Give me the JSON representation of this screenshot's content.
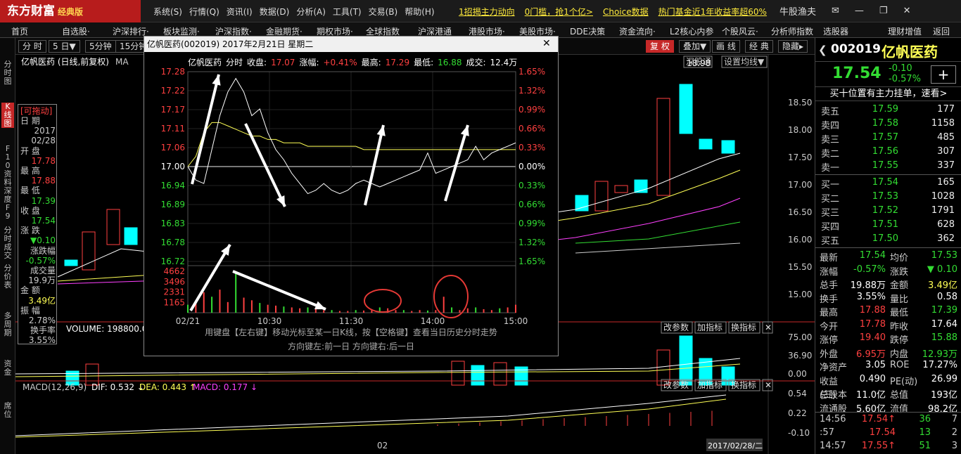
{
  "app": {
    "logo": "东方财富",
    "edition": "经典版",
    "user": "牛股渔夫"
  },
  "menu": [
    "系统(S)",
    "行情(Q)",
    "资讯(I)",
    "数据(D)",
    "分析(A)",
    "工具(T)",
    "交易(B)",
    "帮助(H)"
  ],
  "top_links": [
    "1招揭主力动向",
    "0门槛，抢1个亿>",
    "Choice数据",
    "热门基金近1年收益率超60%"
  ],
  "nav": [
    "首页",
    "自选股·",
    "沪深排行·",
    "板块监测·",
    "沪深指数·",
    "金融期货·",
    "期权市场·",
    "全球指数",
    "沪深港通",
    "港股市场·",
    "美股市场·",
    "DDE决策",
    "资金流向·",
    "L2核心内参",
    "个股风云·",
    "分析师指数",
    "选股器",
    "理财增值",
    "返回"
  ],
  "left_tabs": [
    "分时图",
    "K线图",
    "F10资料",
    "深度F9",
    "分时成交",
    "分价表",
    "多周期",
    "资金",
    "席位"
  ],
  "toolbar": {
    "left": [
      "分 时",
      "5 日▼",
      "5分钟",
      "15分钟"
    ],
    "right": [
      "复 权",
      "叠加▼",
      "画 线",
      "经 典",
      "隐藏▸"
    ]
  },
  "stock": {
    "code": "002019",
    "name": "亿帆医药",
    "price": "17.54",
    "change": "-0.10",
    "pct": "-0.57%"
  },
  "top10": "买十位置有主力挂单，速看>",
  "asks": [
    {
      "n": "卖五",
      "p": "17.59",
      "v": "177"
    },
    {
      "n": "卖四",
      "p": "17.58",
      "v": "1158"
    },
    {
      "n": "卖三",
      "p": "17.57",
      "v": "485"
    },
    {
      "n": "卖二",
      "p": "17.56",
      "v": "307"
    },
    {
      "n": "卖一",
      "p": "17.55",
      "v": "337"
    }
  ],
  "bids": [
    {
      "n": "买一",
      "p": "17.54",
      "v": "165"
    },
    {
      "n": "买二",
      "p": "17.53",
      "v": "1028"
    },
    {
      "n": "买三",
      "p": "17.52",
      "v": "1791"
    },
    {
      "n": "买四",
      "p": "17.51",
      "v": "628"
    },
    {
      "n": "买五",
      "p": "17.50",
      "v": "362"
    }
  ],
  "info": [
    {
      "a": "最新",
      "b": "17.54",
      "bc": "green",
      "c": "均价",
      "d": "17.53",
      "dc": "green"
    },
    {
      "a": "涨幅",
      "b": "-0.57%",
      "bc": "green",
      "c": "涨跌",
      "d": "▼ 0.10",
      "dc": "green"
    },
    {
      "a": "总手",
      "b": "19.88万",
      "bc": "wh",
      "c": "金额",
      "d": "3.49亿",
      "dc": "yel"
    },
    {
      "a": "换手",
      "b": "3.55%",
      "bc": "wh",
      "c": "量比",
      "d": "0.58",
      "dc": "wh"
    },
    {
      "a": "最高",
      "b": "17.88",
      "bc": "red",
      "c": "最低",
      "d": "17.39",
      "dc": "green"
    },
    {
      "a": "今开",
      "b": "17.78",
      "bc": "red",
      "c": "昨收",
      "d": "17.64",
      "dc": "wh"
    },
    {
      "a": "涨停",
      "b": "19.40",
      "bc": "red",
      "c": "跌停",
      "d": "15.88",
      "dc": "green"
    },
    {
      "a": "外盘",
      "b": "6.95万",
      "bc": "red",
      "c": "内盘",
      "d": "12.93万",
      "dc": "green"
    },
    {
      "a": "净资产",
      "b": "3.05",
      "bc": "wh",
      "c": "ROE",
      "d": "17.27%",
      "dc": "wh"
    },
    {
      "a": "收益(三)",
      "b": "0.490",
      "bc": "wh",
      "c": "PE(动)",
      "d": "26.99",
      "dc": "wh"
    },
    {
      "a": "总股本",
      "b": "11.0亿",
      "bc": "wh",
      "c": "总值",
      "d": "193亿",
      "dc": "wh"
    },
    {
      "a": "流通股",
      "b": "5.60亿",
      "bc": "wh",
      "c": "流值",
      "d": "98.2亿",
      "dc": "wh"
    }
  ],
  "ticks": [
    {
      "t": "14:56",
      "p": "17.54↑",
      "v": "36",
      "n": "7"
    },
    {
      "t": ":57",
      "p": "17.54",
      "v": "13",
      "n": "2"
    },
    {
      "t": "14:57",
      "p": "17.55↑",
      "v": "51",
      "n": "3"
    }
  ],
  "kline": {
    "title": "亿帆医药 (日线,前复权)",
    "ma": "MA",
    "peak": "18.98",
    "price_axis": [
      "18.50",
      "18.00",
      "17.50",
      "17.00",
      "16.50",
      "16.00",
      "15.50",
      "15.00"
    ],
    "badges": [
      "深股通",
      "设置均线▼"
    ],
    "vol_label": "VOLUME: 198800.00",
    "vol_axis": [
      "75.00",
      "36.90",
      "0.00"
    ],
    "macd_label": "MACD(12,26,9)",
    "dif": "DIF: 0.532 ↓",
    "dea": "DEA: 0.443 ↑",
    "macd": "MACD: 0.177 ↓",
    "macd_axis": [
      "0.54",
      "0.22",
      "-0.10"
    ],
    "btns": [
      "改参数",
      "加指标",
      "换指标",
      "✕"
    ],
    "date_axis": "02",
    "cursor_date": "2017/02/28/二"
  },
  "panel": {
    "title": "[可拖动]",
    "rows": [
      [
        "日",
        "期"
      ],
      [
        "2017",
        ""
      ],
      [
        "02/28",
        ""
      ],
      [
        "开",
        "盘"
      ],
      [
        "17.78",
        ""
      ],
      [
        "最",
        "高"
      ],
      [
        "17.88",
        ""
      ],
      [
        "最",
        "低"
      ],
      [
        "17.39",
        ""
      ],
      [
        "收",
        "盘"
      ],
      [
        "17.54",
        ""
      ],
      [
        "涨",
        "跌"
      ],
      [
        "▼0.10",
        ""
      ],
      [
        "涨跌幅",
        ""
      ],
      [
        "-0.57%",
        ""
      ],
      [
        "成交量",
        ""
      ],
      [
        "19.9万",
        ""
      ],
      [
        "金",
        "额"
      ],
      [
        "3.49亿",
        ""
      ],
      [
        "振",
        "幅"
      ],
      [
        "2.78%",
        ""
      ],
      [
        "换手率",
        ""
      ],
      [
        "3.55%",
        ""
      ]
    ]
  },
  "dialog": {
    "title": "亿帆医药(002019)",
    "date": "2017年2月21日 星期二",
    "header": {
      "name": "亿帆医药",
      "type": "分时",
      "l1": "收盘:",
      "v1": "17.07",
      "l2": "涨幅:",
      "v2": "+0.41%",
      "l3": "最高:",
      "v3": "17.29",
      "l4": "最低:",
      "v4": "16.88",
      "l5": "成交:",
      "v5": "12.4万"
    },
    "hint1": "用键盘【左右键】移动光标至某一日K线，按【空格键】查看当日历史分时走势",
    "hint2": "方向键左:前一日    方向键右:后一日",
    "chart_data": {
      "type": "line",
      "x_ticks": [
        "02/21",
        "10:30",
        "11:30",
        "14:00",
        "15:00"
      ],
      "y_ticks": [
        "17.28",
        "17.22",
        "17.17",
        "17.11",
        "17.06",
        "17.00",
        "16.94",
        "16.89",
        "16.83",
        "16.78",
        "16.72"
      ],
      "pct_ticks": [
        "1.65%",
        "1.32%",
        "0.99%",
        "0.66%",
        "0.33%",
        "0.00%",
        "0.33%",
        "0.66%",
        "0.99%",
        "1.32%",
        "1.65%"
      ],
      "ylim": [
        16.72,
        17.28
      ],
      "prev_close": 17.0,
      "price": [
        17.0,
        16.96,
        16.95,
        17.05,
        17.15,
        17.22,
        17.26,
        17.22,
        17.15,
        17.17,
        17.1,
        17.05,
        17.02,
        16.98,
        16.95,
        16.92,
        16.93,
        16.95,
        16.93,
        16.92,
        16.93,
        16.95,
        16.96,
        16.95,
        16.94,
        16.95,
        16.96,
        16.97,
        16.98,
        16.99,
        17.04,
        16.98,
        16.99,
        17.0,
        17.01,
        17.02,
        17.06,
        17.02,
        17.04,
        17.05,
        17.06,
        17.07
      ],
      "avg": [
        17.0,
        17.03,
        17.1,
        17.13,
        17.13,
        17.12,
        17.11,
        17.1,
        17.09,
        17.09,
        17.08,
        17.08,
        17.07,
        17.07,
        17.07,
        17.06,
        17.06,
        17.06,
        17.06,
        17.06,
        17.06,
        17.06,
        17.05,
        17.05,
        17.05,
        17.05,
        17.05,
        17.05,
        17.05,
        17.05,
        17.05,
        17.05,
        17.05,
        17.05,
        17.05,
        17.05,
        17.05,
        17.05,
        17.05,
        17.05,
        17.05,
        17.05
      ],
      "vol_ticks": [
        "4662",
        "3496",
        "2331",
        "1165"
      ],
      "vol_max": 4662,
      "volume": [
        900,
        1400,
        2300,
        1800,
        2600,
        1200,
        4600,
        1700,
        1400,
        1100,
        900,
        800,
        700,
        600,
        500,
        600,
        400,
        300,
        300,
        200,
        200,
        300,
        250,
        400,
        600,
        500,
        300,
        300,
        200,
        300,
        250,
        300,
        1800,
        600,
        300,
        500,
        600,
        400,
        300,
        500,
        600,
        900
      ]
    }
  }
}
